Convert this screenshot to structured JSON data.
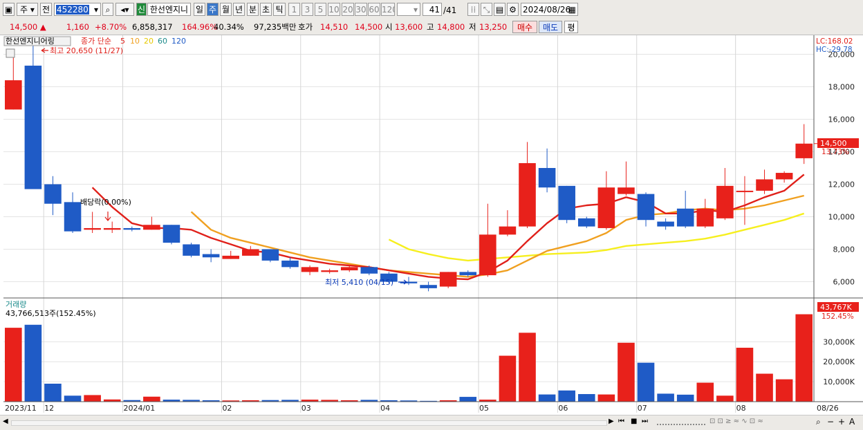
{
  "toolbar": {
    "period_1": "주",
    "period_2": "전",
    "code": "452280",
    "badge": "신",
    "stock_name": "한선엔지니",
    "periods": [
      "일",
      "주",
      "월",
      "년",
      "분",
      "초",
      "틱"
    ],
    "selected_period": "주",
    "intervals": [
      "1",
      "3",
      "5",
      "10",
      "20",
      "30",
      "60",
      "120"
    ],
    "page": "41",
    "page_total": "/41",
    "date": "2024/08/26"
  },
  "quote": {
    "price": "14,500",
    "change": "1,160",
    "change_pct": "+8.70%",
    "volume": "6,858,317",
    "vol_ratio": "164.96%",
    "turnover": "40.34%",
    "amount": "97,235백만",
    "bid_label": "호가",
    "ask": "14,510",
    "bid": "14,500",
    "open_label": "시",
    "open": "13,600",
    "high_label": "고",
    "high": "14,800",
    "low_label": "저",
    "low": "13,250",
    "buy_button": "매수",
    "sell_button": "매도",
    "eval_button": "평"
  },
  "price_panel": {
    "stock_label": "한선엔지니어링",
    "ma_title": "종가 단순",
    "ma_periods": [
      "5",
      "10",
      "20",
      "60",
      "120"
    ],
    "high_note": "최고 20,650 (11/27)",
    "low_note": "최저 5,410 (04/15)",
    "dividend_note": "배당락(0.00%)",
    "lc": "LC:168.02",
    "hc": "HC:-29.78",
    "price_tag": "14,500",
    "price_tag_pct": "13.73%",
    "y_ticks": [
      "20,000",
      "18,000",
      "16,000",
      "14,000",
      "12,000",
      "10,000",
      "8,000",
      "6,000"
    ]
  },
  "volume_panel": {
    "title": "거래량",
    "summary": "43,766,513주(152.45%)",
    "tag": "43,767K",
    "tag_pct": "152.45%",
    "y_ticks": [
      "30,000K",
      "20,000K",
      "10,000K"
    ]
  },
  "x_axis": {
    "labels": [
      "2023/11",
      "12",
      "2024/01",
      "02",
      "03",
      "04",
      "05",
      "06",
      "07",
      "08",
      "08/26"
    ]
  },
  "colors": {
    "up": "#e8211b",
    "down": "#1f5bc6",
    "ma5": "#e0201a",
    "ma10": "#f0a020",
    "ma20": "#f6ef1e"
  },
  "chart_data": {
    "type": "candlestick",
    "title": "한선엔지니어링",
    "subtitle": "종가 단순 5 10 20 60 120",
    "price_ylim": [
      5000,
      21000
    ],
    "volume_ylim": [
      0,
      45000000
    ],
    "candles": [
      {
        "open": 16600,
        "high": 19800,
        "low": 16600,
        "close": 18400,
        "volume": 37000000
      },
      {
        "open": 19300,
        "high": 20650,
        "low": 11700,
        "close": 11700,
        "volume": 38500000
      },
      {
        "open": 12000,
        "high": 12500,
        "low": 10100,
        "close": 10800,
        "volume": 9000000
      },
      {
        "open": 10900,
        "high": 11500,
        "low": 9000,
        "close": 9100,
        "volume": 3000000
      },
      {
        "open": 9200,
        "high": 10300,
        "low": 9000,
        "close": 9300,
        "volume": 3300000
      },
      {
        "open": 9200,
        "high": 9700,
        "low": 9000,
        "close": 9300,
        "volume": 1100000
      },
      {
        "open": 9300,
        "high": 9400,
        "low": 9100,
        "close": 9200,
        "volume": 800000
      },
      {
        "open": 9200,
        "high": 10000,
        "low": 9200,
        "close": 9500,
        "volume": 2500000
      },
      {
        "open": 9500,
        "high": 9500,
        "low": 8300,
        "close": 8400,
        "volume": 1000000
      },
      {
        "open": 8300,
        "high": 8400,
        "low": 7500,
        "close": 7600,
        "volume": 900000
      },
      {
        "open": 7700,
        "high": 8000,
        "low": 7200,
        "close": 7500,
        "volume": 700000
      },
      {
        "open": 7400,
        "high": 7900,
        "low": 7400,
        "close": 7600,
        "volume": 600000
      },
      {
        "open": 7600,
        "high": 8200,
        "low": 7600,
        "close": 8000,
        "volume": 700000
      },
      {
        "open": 8000,
        "high": 8000,
        "low": 7200,
        "close": 7300,
        "volume": 800000
      },
      {
        "open": 7300,
        "high": 7500,
        "low": 6800,
        "close": 6900,
        "volume": 900000
      },
      {
        "open": 6900,
        "high": 7000,
        "low": 6400,
        "close": 6600,
        "volume": 1000000
      },
      {
        "open": 6600,
        "high": 6800,
        "low": 6500,
        "close": 6700,
        "volume": 900000
      },
      {
        "open": 6700,
        "high": 7000,
        "low": 6600,
        "close": 6900,
        "volume": 700000
      },
      {
        "open": 6900,
        "high": 7000,
        "low": 6400,
        "close": 6500,
        "volume": 900000
      },
      {
        "open": 6500,
        "high": 6600,
        "low": 5900,
        "close": 6000,
        "volume": 700000
      },
      {
        "open": 6000,
        "high": 6300,
        "low": 5800,
        "close": 5900,
        "volume": 600000
      },
      {
        "open": 5800,
        "high": 6000,
        "low": 5410,
        "close": 5600,
        "volume": 400000
      },
      {
        "open": 5700,
        "high": 6600,
        "low": 5600,
        "close": 6600,
        "volume": 700000
      },
      {
        "open": 6600,
        "high": 6700,
        "low": 6300,
        "close": 6400,
        "volume": 2400000
      },
      {
        "open": 6400,
        "high": 10800,
        "low": 6300,
        "close": 8900,
        "volume": 1000000
      },
      {
        "open": 8900,
        "high": 10400,
        "low": 8800,
        "close": 9400,
        "volume": 23000000
      },
      {
        "open": 9400,
        "high": 14600,
        "low": 9300,
        "close": 13300,
        "volume": 34500000
      },
      {
        "open": 13000,
        "high": 14200,
        "low": 11500,
        "close": 11800,
        "volume": 3600000
      },
      {
        "open": 11900,
        "high": 11900,
        "low": 9600,
        "close": 9800,
        "volume": 5600000
      },
      {
        "open": 9900,
        "high": 10000,
        "low": 9300,
        "close": 9400,
        "volume": 3800000
      },
      {
        "open": 9300,
        "high": 12800,
        "low": 9200,
        "close": 11800,
        "volume": 3600000
      },
      {
        "open": 11800,
        "high": 13400,
        "low": 11300,
        "close": 11400,
        "volume": 29500000
      },
      {
        "open": 11400,
        "high": 11500,
        "low": 9400,
        "close": 9800,
        "volume": 19500000
      },
      {
        "open": 9700,
        "high": 9900,
        "low": 9200,
        "close": 9400,
        "volume": 4000000
      },
      {
        "open": 9400,
        "high": 11600,
        "low": 9300,
        "close": 10500,
        "volume": 3500000
      },
      {
        "open": 10500,
        "high": 11100,
        "low": 9300,
        "close": 9400,
        "volume": 9500000
      },
      {
        "open": 9900,
        "high": 13000,
        "low": 9800,
        "close": 11900,
        "volume": 3000000
      },
      {
        "open": 11600,
        "high": 12500,
        "low": 9500,
        "close": 11600,
        "volume": 27000000
      },
      {
        "open": 11600,
        "high": 12900,
        "low": 11400,
        "close": 12300,
        "volume": 14000000
      },
      {
        "open": 12300,
        "high": 12800,
        "low": 12100,
        "close": 12700,
        "volume": 11200000
      },
      {
        "open": 13600,
        "high": 15700,
        "low": 13250,
        "close": 14500,
        "volume": 43766513
      }
    ],
    "candle_colors": [
      "up",
      "down",
      "down",
      "down",
      "up",
      "up",
      "down",
      "up",
      "down",
      "down",
      "down",
      "up",
      "up",
      "down",
      "down",
      "up",
      "up",
      "up",
      "down",
      "down",
      "down",
      "down",
      "up",
      "down",
      "up",
      "up",
      "up",
      "down",
      "down",
      "down",
      "up",
      "up",
      "down",
      "down",
      "down",
      "up",
      "up",
      "up",
      "up",
      "up",
      "up"
    ],
    "ma5": [
      null,
      null,
      null,
      null,
      11800,
      10600,
      9600,
      9300,
      9300,
      9200,
      8700,
      8300,
      7900,
      7800,
      7500,
      7300,
      7100,
      7000,
      6900,
      6700,
      6500,
      6300,
      6200,
      6150,
      6600,
      7300,
      8500,
      9600,
      10500,
      10700,
      10800,
      11200,
      10900,
      10200,
      10200,
      10400,
      10300,
      10700,
      11200,
      11600,
      12600
    ],
    "ma10": [
      null,
      null,
      null,
      null,
      null,
      null,
      null,
      null,
      null,
      10300,
      9200,
      8700,
      8400,
      8100,
      7800,
      7500,
      7300,
      7100,
      6900,
      6700,
      6600,
      6500,
      6400,
      6300,
      6450,
      6700,
      7300,
      7900,
      8200,
      8500,
      9000,
      9800,
      10100,
      10200,
      10400,
      10500,
      10400,
      10500,
      10700,
      11000,
      11300
    ],
    "ma20": [
      null,
      null,
      null,
      null,
      null,
      null,
      null,
      null,
      null,
      null,
      null,
      null,
      null,
      null,
      null,
      null,
      null,
      null,
      null,
      8600,
      8000,
      7700,
      7450,
      7300,
      7400,
      7500,
      7600,
      7700,
      7750,
      7800,
      7950,
      8200,
      8300,
      8400,
      8500,
      8650,
      8900,
      9200,
      9500,
      9800,
      10200
    ],
    "x_labels": [
      "2023/11",
      "12",
      "2024/01",
      "02",
      "03",
      "04",
      "05",
      "06",
      "07",
      "08",
      "08/26"
    ]
  }
}
